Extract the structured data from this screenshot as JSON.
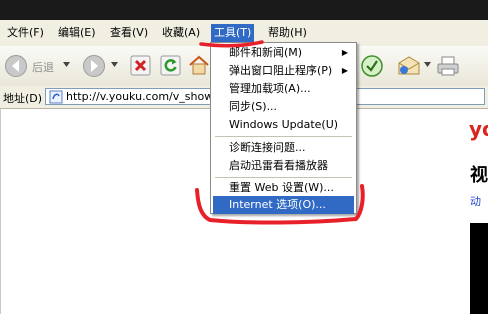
{
  "menubar": {
    "items": [
      {
        "label": "文件(F)"
      },
      {
        "label": "编辑(E)"
      },
      {
        "label": "查看(V)"
      },
      {
        "label": "收藏(A)"
      },
      {
        "label": "工具(T)"
      },
      {
        "label": "帮助(H)"
      }
    ],
    "active_item": "工具(T)"
  },
  "toolbar": {
    "back_label": "后退",
    "icons": [
      "back-icon",
      "dropdown-arrow-icon",
      "forward-icon",
      "stop-icon",
      "refresh-icon",
      "home-icon",
      "media-icon",
      "mail-icon",
      "print-icon"
    ]
  },
  "addressbar": {
    "label": "地址(D)",
    "url": "http://v.youku.com/v_show/id"
  },
  "tools_menu": {
    "items": [
      {
        "label": "邮件和新闻(M)",
        "submenu": true
      },
      {
        "label": "弹出窗口阻止程序(P)",
        "submenu": true
      },
      {
        "label": "管理加载项(A)..."
      },
      {
        "label": "同步(S)..."
      },
      {
        "label": "Windows Update(U)"
      },
      {
        "label": "诊断连接问题..."
      },
      {
        "label": "启动迅雷看看播放器"
      },
      {
        "label": "重置 Web 设置(W)..."
      },
      {
        "label": "Internet 选项(O)...",
        "highlighted": true
      }
    ]
  },
  "page": {
    "logo_fragment": "yo",
    "heading_fragment": "视",
    "link_fragment": "动"
  },
  "colors": {
    "menu_highlight": "#316ac5",
    "annotation_red": "#e8202a",
    "logo_red": "#d9261c",
    "link_blue": "#2244cc"
  }
}
